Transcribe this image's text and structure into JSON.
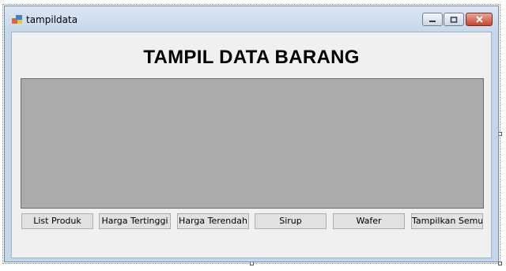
{
  "window": {
    "title": "tampildata",
    "icon": "form-icon"
  },
  "controls": {
    "minimize_icon": "minimize-icon",
    "maximize_icon": "maximize-icon",
    "close_icon": "close-icon"
  },
  "form": {
    "heading": "TAMPIL DATA BARANG"
  },
  "buttons": [
    {
      "label": "List Produk"
    },
    {
      "label": "Harga Tertinggi"
    },
    {
      "label": "Harga Terendah"
    },
    {
      "label": "Sirup"
    },
    {
      "label": "Wafer"
    },
    {
      "label": "Tampilkan Semua"
    }
  ],
  "colors": {
    "grid_background": "#ababab",
    "form_background": "#f0f0f0",
    "close_button": "#c7452e"
  }
}
